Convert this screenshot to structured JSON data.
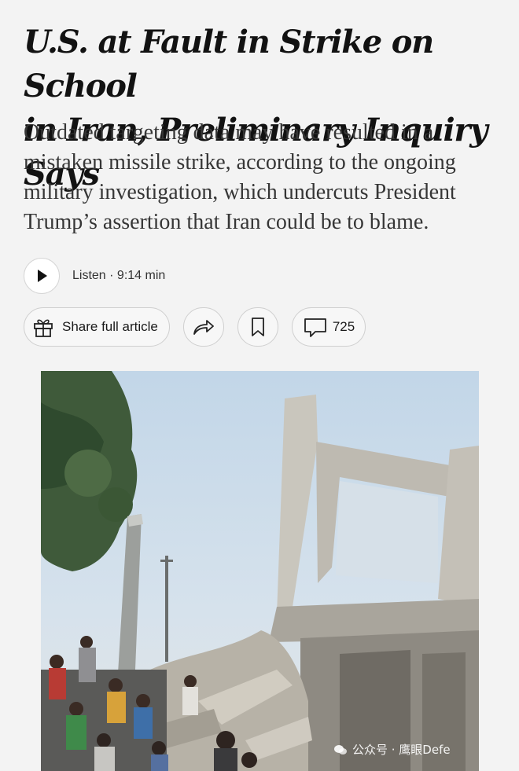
{
  "article": {
    "headline_line1": "U.S. at Fault in Strike on School",
    "headline_line2": "in Iran, Preliminary Inquiry Says",
    "dek": "Outdated targeting data may have resulted in a mistaken missile strike, according to the ongoing military investigation, which undercuts President Trump’s assertion that Iran could be to blame."
  },
  "audio": {
    "play_icon": "play-icon",
    "listen_label": "Listen · 9:14 min"
  },
  "actions": {
    "share_label": "Share full article",
    "share_icon": "gift-icon",
    "forward_icon": "share-arrow-icon",
    "bookmark_icon": "bookmark-icon",
    "comment_icon": "comment-icon",
    "comment_count": "725"
  },
  "photo": {
    "alt": "",
    "watermark_text": "公众号 · 鹰眼Defe"
  },
  "colors": {
    "background": "#f3f3f3",
    "headline": "#121212",
    "dek": "#363636"
  }
}
